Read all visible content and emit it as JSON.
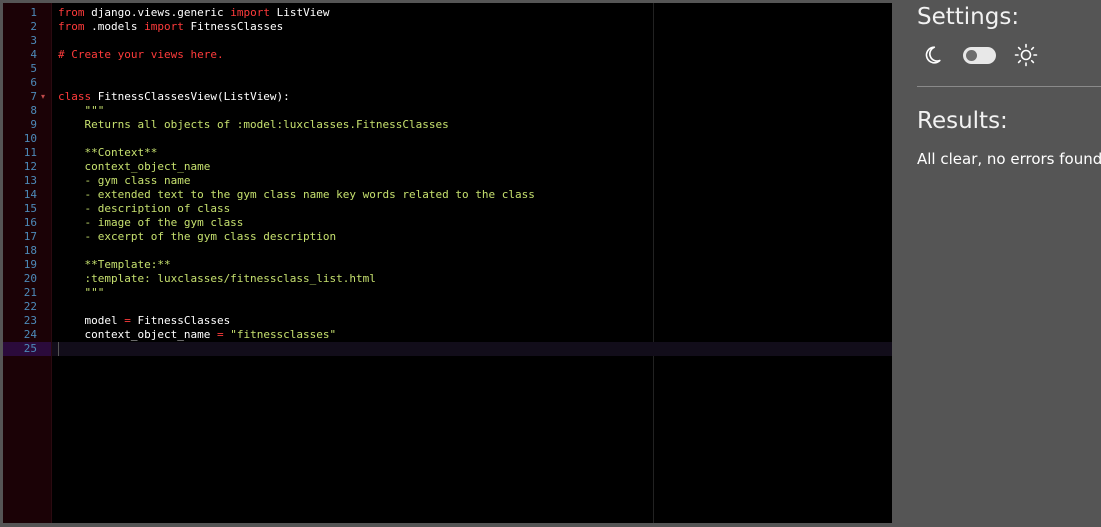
{
  "editor": {
    "lines": [
      {
        "n": "1",
        "t": [
          [
            "kw",
            "from"
          ],
          [
            "id",
            " django.views.generic "
          ],
          [
            "kw",
            "import"
          ],
          [
            "id",
            " ListView"
          ]
        ]
      },
      {
        "n": "2",
        "t": [
          [
            "kw",
            "from"
          ],
          [
            "id",
            " .models "
          ],
          [
            "kw",
            "import"
          ],
          [
            "id",
            " FitnessClasses"
          ]
        ]
      },
      {
        "n": "3",
        "t": []
      },
      {
        "n": "4",
        "t": [
          [
            "cm",
            "# Create your views here."
          ]
        ]
      },
      {
        "n": "5",
        "t": []
      },
      {
        "n": "6",
        "t": []
      },
      {
        "n": "7",
        "fold": true,
        "t": [
          [
            "kw",
            "class"
          ],
          [
            "id",
            " FitnessClassesView(ListView):"
          ]
        ]
      },
      {
        "n": "8",
        "t": [
          [
            "str",
            "    \"\"\""
          ]
        ]
      },
      {
        "n": "9",
        "t": [
          [
            "str",
            "    Returns all objects of :model:luxclasses.FitnessClasses"
          ]
        ]
      },
      {
        "n": "10",
        "t": []
      },
      {
        "n": "11",
        "t": [
          [
            "str",
            "    **Context**"
          ]
        ]
      },
      {
        "n": "12",
        "t": [
          [
            "str",
            "    context_object_name"
          ]
        ]
      },
      {
        "n": "13",
        "t": [
          [
            "str",
            "    - gym class name"
          ]
        ]
      },
      {
        "n": "14",
        "t": [
          [
            "str",
            "    - extended text to the gym class name key words related to the class"
          ]
        ]
      },
      {
        "n": "15",
        "t": [
          [
            "str",
            "    - description of class"
          ]
        ]
      },
      {
        "n": "16",
        "t": [
          [
            "str",
            "    - image of the gym class"
          ]
        ]
      },
      {
        "n": "17",
        "t": [
          [
            "str",
            "    - excerpt of the gym class description"
          ]
        ]
      },
      {
        "n": "18",
        "t": []
      },
      {
        "n": "19",
        "t": [
          [
            "str",
            "    **Template:**"
          ]
        ]
      },
      {
        "n": "20",
        "t": [
          [
            "str",
            "    :template: luxclasses/fitnessclass_list.html"
          ]
        ]
      },
      {
        "n": "21",
        "t": [
          [
            "str",
            "    \"\"\""
          ]
        ]
      },
      {
        "n": "22",
        "t": []
      },
      {
        "n": "23",
        "t": [
          [
            "id",
            "    model "
          ],
          [
            "op",
            "="
          ],
          [
            "id",
            " FitnessClasses"
          ]
        ]
      },
      {
        "n": "24",
        "t": [
          [
            "id",
            "    context_object_name "
          ],
          [
            "op",
            "="
          ],
          [
            "id",
            " "
          ],
          [
            "str",
            "\"fitnessclasses\""
          ]
        ]
      },
      {
        "n": "25",
        "active": true,
        "t": []
      }
    ]
  },
  "settings": {
    "title": "Settings:",
    "dark_icon": "moon-icon",
    "light_icon": "sun-icon",
    "toggle_state": "off"
  },
  "results": {
    "title": "Results:",
    "message": "All clear, no errors found"
  },
  "colors": {
    "keyword": "#ff3b3b",
    "string": "#c6e06e",
    "line_number": "#4d8ab8",
    "panel_bg": "#555555"
  }
}
